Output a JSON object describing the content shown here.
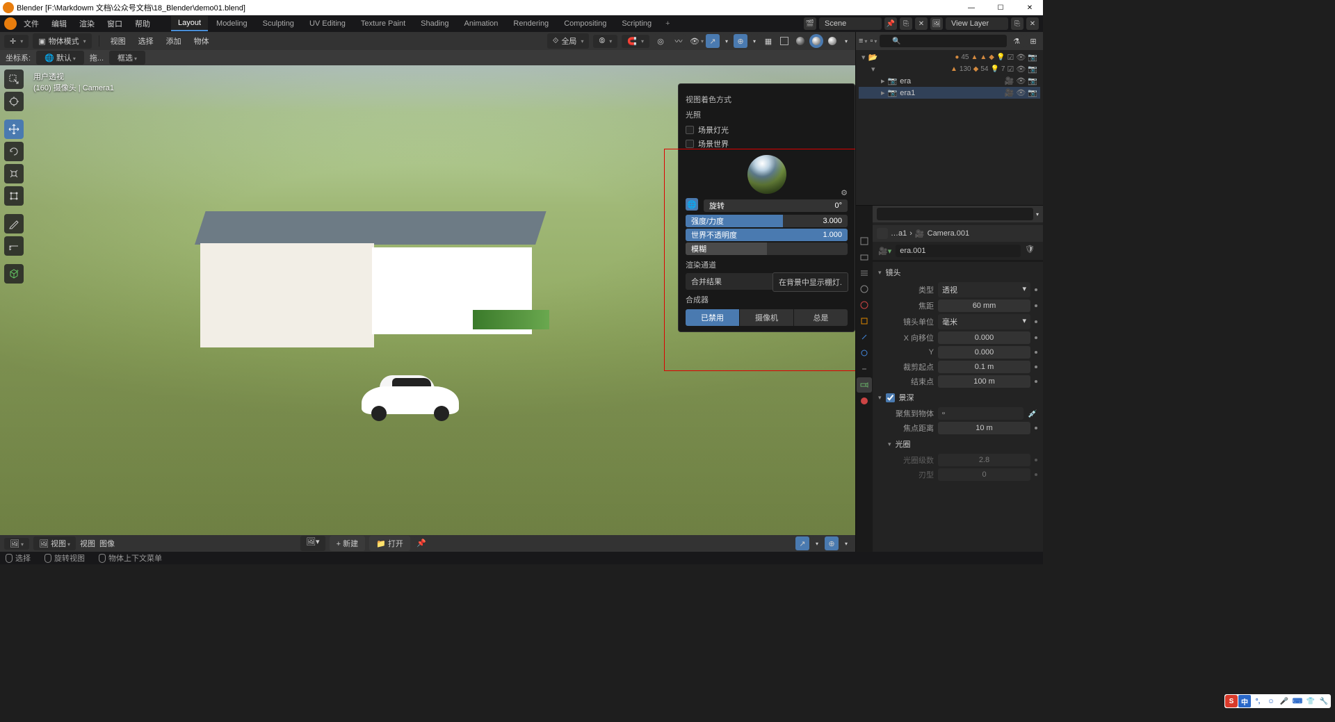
{
  "window": {
    "title": "Blender [F:\\Markdowm 文档\\公众号文档\\18_Blender\\demo01.blend]",
    "minimize": "—",
    "maximize": "☐",
    "close": "✕"
  },
  "menus": {
    "file": "文件",
    "edit": "编辑",
    "render": "渲染",
    "window": "窗口",
    "help": "帮助"
  },
  "workspaces": {
    "layout": "Layout",
    "modeling": "Modeling",
    "sculpting": "Sculpting",
    "uv": "UV Editing",
    "texture": "Texture Paint",
    "shading": "Shading",
    "animation": "Animation",
    "rendering": "Rendering",
    "compositing": "Compositing",
    "scripting": "Scripting",
    "add": "+"
  },
  "top_right": {
    "scene": "Scene",
    "viewlayer": "View Layer"
  },
  "vp_header": {
    "mode": "物体模式",
    "view": "视图",
    "select": "选择",
    "add": "添加",
    "object": "物体",
    "global": "全局"
  },
  "vp_sub": {
    "orient": "坐标系:",
    "orient_v": "默认",
    "drag": "拖...",
    "boxsel": "框选"
  },
  "vp_overlay": {
    "l1": "用户透视",
    "l2": "(160) 摄像头 | Camera1"
  },
  "shading": {
    "title": "视图着色方式",
    "lighting": "光照",
    "scene_light": "场景灯光",
    "scene_world": "场景世界",
    "rotation": "旋转",
    "rotation_v": "0°",
    "strength": "强度/力度",
    "strength_v": "3.000",
    "world_opacity": "世界不透明度",
    "world_opacity_v": "1.000",
    "blur": "模糊",
    "tooltip": "在背景中显示棚灯.",
    "render_pass": "渲染通道",
    "render_pass_v": "合并结果",
    "compositor": "合成器",
    "comp_disabled": "已禁用",
    "comp_camera": "摄像机",
    "comp_always": "总是"
  },
  "vp_footer": {
    "editor": "视图",
    "view": "视图",
    "image": "图像",
    "new": "新建",
    "open": "打开",
    "plus": "+"
  },
  "outliner": {
    "stats1": "45",
    "stats2": "130",
    "stats3": "54",
    "stats4": "7",
    "row_era": "era",
    "row_era1": "era1",
    "search_ph": ""
  },
  "props": {
    "crumb_obj": "…a1",
    "crumb_cam": "Camera.001",
    "name": "era.001",
    "lens_panel": "镜头 ▾",
    "type_lbl": "类型",
    "type_v": "透视",
    "focal_lbl": "焦距",
    "focal_v": "60 mm",
    "unit_lbl": "镜头单位",
    "unit_v": "毫米",
    "shiftx_lbl": "X 向移位",
    "shiftx_v": "0.000",
    "shifty_lbl": "Y",
    "shifty_v": "0.000",
    "clip_start_lbl": "裁剪起点",
    "clip_start_v": "0.1 m",
    "clip_end_lbl": "结束点",
    "clip_end_v": "100 m",
    "dof_panel": "景深",
    "focus_obj_lbl": "聚焦到物体",
    "focus_dist_lbl": "焦点距离",
    "focus_dist_v": "10 m",
    "aperture_panel": "光圈",
    "fstop_lbl": "光圈级数",
    "fstop_v": "2.8",
    "blades_lbl": "刃型",
    "blades_v": "0"
  },
  "status": {
    "select": "选择",
    "rotate": "旋转视图",
    "context": "物体上下文菜单"
  }
}
